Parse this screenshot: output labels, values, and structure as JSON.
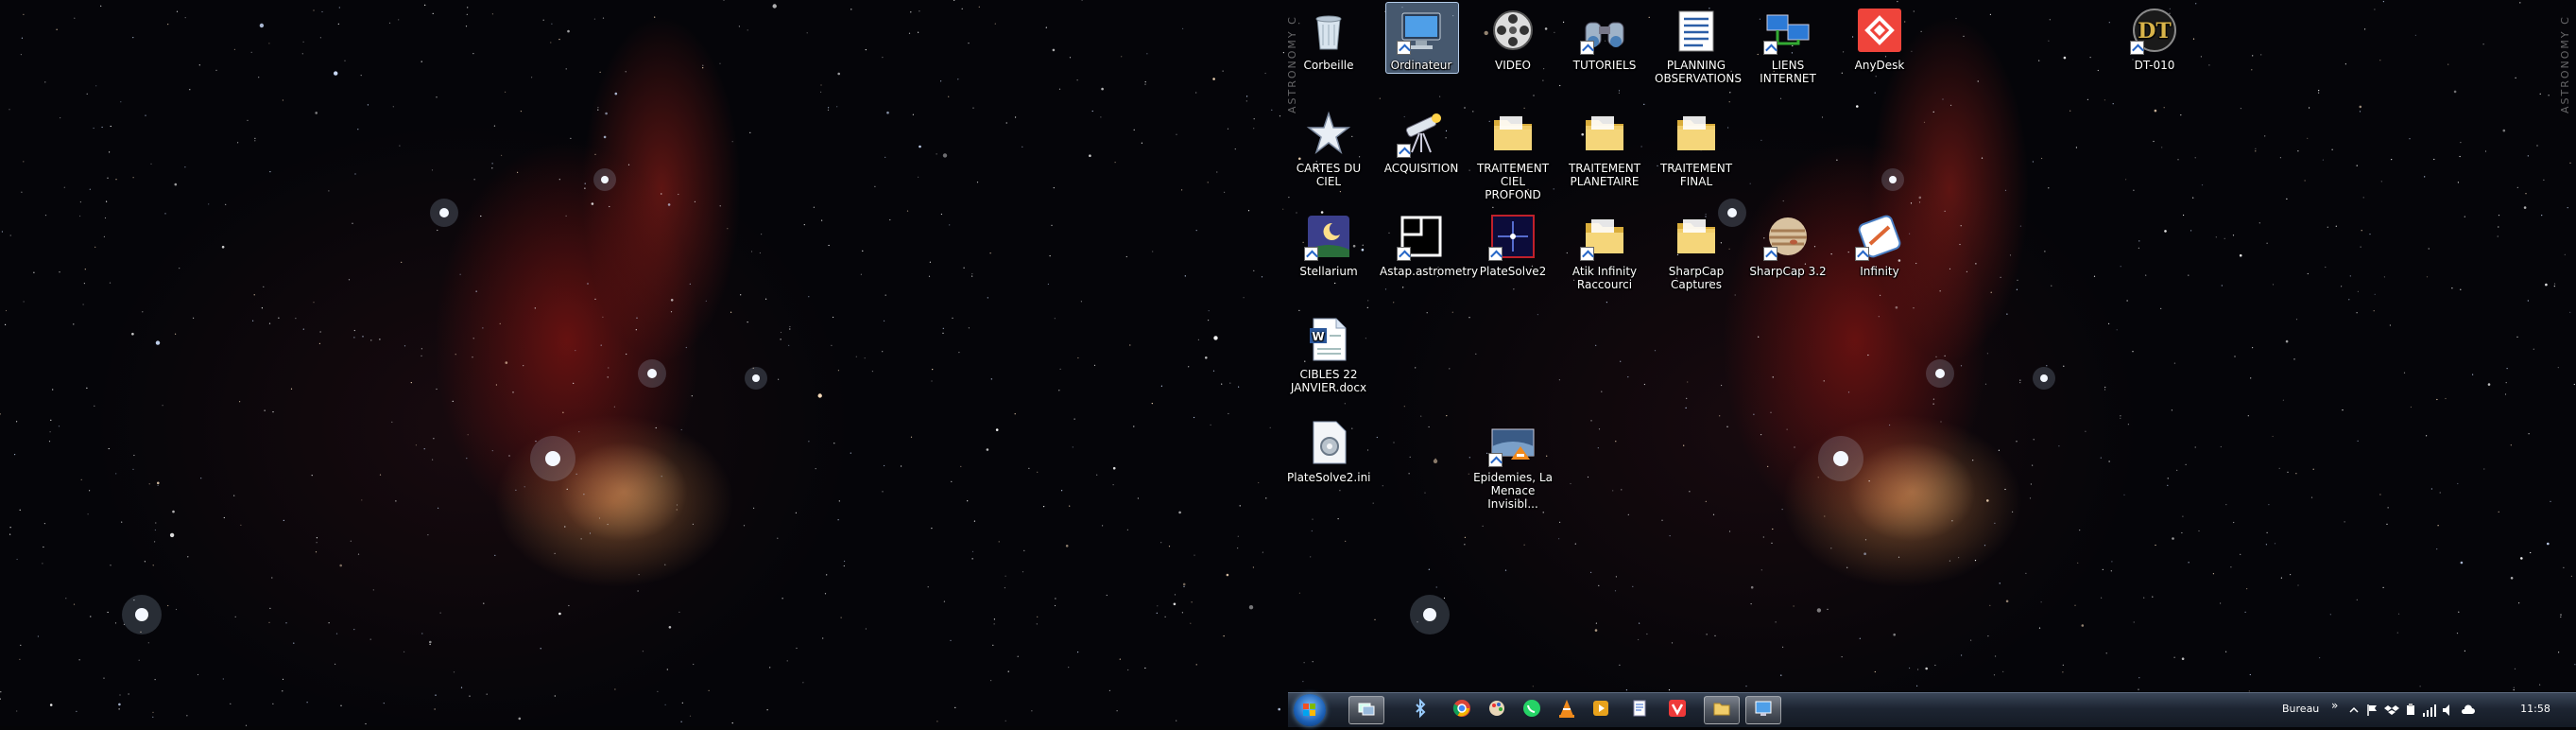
{
  "watermark_text": "ASTRONOMY C",
  "desktop_icons": [
    {
      "label": "Corbeille",
      "icon": "recycle-bin-icon"
    },
    {
      "label": "Ordinateur",
      "icon": "computer-icon"
    },
    {
      "label": "VIDEO",
      "icon": "film-reel-icon"
    },
    {
      "label": "TUTORIELS",
      "icon": "binoculars-icon"
    },
    {
      "label": "PLANNING OBSERVATIONS",
      "icon": "list-icon"
    },
    {
      "label": "LIENS INTERNET",
      "icon": "network-icon"
    },
    {
      "label": "AnyDesk",
      "icon": "anydesk-icon"
    },
    {
      "label": "DT-010",
      "icon": "dt-logo-icon"
    },
    {
      "label": "CARTES DU CIEL",
      "icon": "star-icon"
    },
    {
      "label": "ACQUISITION",
      "icon": "telescope-icon"
    },
    {
      "label": "TRAITEMENT CIEL PROFOND",
      "icon": "folder-icon"
    },
    {
      "label": "TRAITEMENT PLANETAIRE",
      "icon": "folder-icon"
    },
    {
      "label": "TRAITEMENT FINAL",
      "icon": "folder-icon"
    },
    {
      "label": "Stellarium",
      "icon": "stellarium-icon"
    },
    {
      "label": "Astap.astrometry",
      "icon": "astap-icon"
    },
    {
      "label": "PlateSolve2",
      "icon": "platesolve-icon"
    },
    {
      "label": "Atik Infinity Raccourci",
      "icon": "folder-shortcut-icon"
    },
    {
      "label": "SharpCap Captures",
      "icon": "folder-icon"
    },
    {
      "label": "SharpCap 3.2",
      "icon": "jupiter-icon"
    },
    {
      "label": "Infinity",
      "icon": "infinity-app-icon"
    },
    {
      "label": "CIBLES 22 JANVIER.docx",
      "icon": "word-document-icon"
    },
    {
      "label": "PlateSolve2.ini",
      "icon": "ini-file-icon"
    },
    {
      "label": "Epidemies, La Menace Invisibl...",
      "icon": "video-file-icon"
    }
  ],
  "taskbar": {
    "toolbar_label": "Bureau",
    "chevron": "»",
    "clock": "11:58",
    "pinned": [
      {
        "icon": "switch-windows-icon",
        "active": true
      },
      {
        "icon": "bluetooth-icon",
        "active": false
      },
      {
        "icon": "chrome-icon",
        "active": false
      },
      {
        "icon": "paint-icon",
        "active": false
      },
      {
        "icon": "whatsapp-icon",
        "active": false
      },
      {
        "icon": "vlc-icon",
        "active": false
      },
      {
        "icon": "media-player-icon",
        "active": false
      },
      {
        "icon": "notepad-icon",
        "active": false
      },
      {
        "icon": "vivaldi-icon",
        "active": false
      },
      {
        "icon": "file-explorer-icon",
        "active": true
      },
      {
        "icon": "computer-window-icon",
        "active": true
      }
    ]
  },
  "colors": {
    "taskbar_top": "#3a4658",
    "taskbar_bottom": "#141a24",
    "selection": "#96bee8",
    "folder": "#e8c35a",
    "anydesk": "#ef443b"
  }
}
